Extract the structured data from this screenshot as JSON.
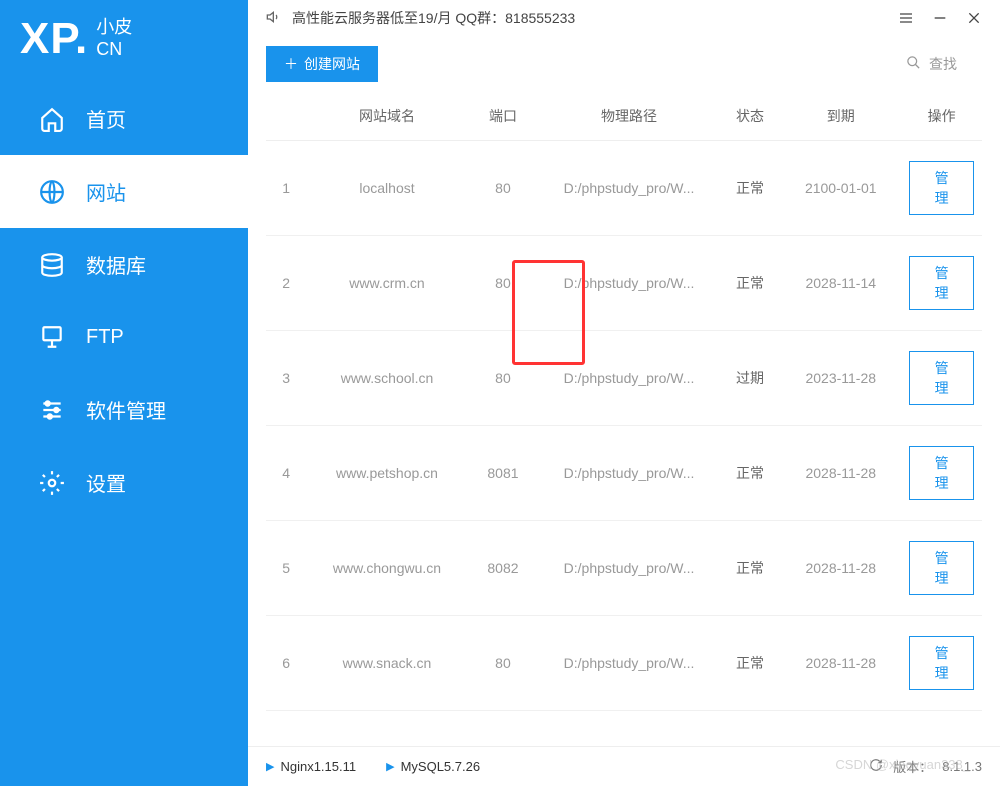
{
  "logo": {
    "xp": "XP.",
    "sub1": "小皮",
    "sub2": "CN"
  },
  "sidebar": {
    "items": [
      {
        "label": "首页",
        "icon": "home-icon"
      },
      {
        "label": "网站",
        "icon": "globe-icon"
      },
      {
        "label": "数据库",
        "icon": "database-icon"
      },
      {
        "label": "FTP",
        "icon": "ftp-icon"
      },
      {
        "label": "软件管理",
        "icon": "sliders-icon"
      },
      {
        "label": "设置",
        "icon": "gear-icon"
      }
    ]
  },
  "topbar": {
    "announcement": "高性能云服务器低至19/月  QQ群：818555233"
  },
  "toolbar": {
    "create_label": "创建网站",
    "search_placeholder": "查找"
  },
  "table": {
    "headers": {
      "domain": "网站域名",
      "port": "端口",
      "path": "物理路径",
      "status": "状态",
      "expire": "到期",
      "action": "操作"
    },
    "manage_label": "管理",
    "rows": [
      {
        "idx": "1",
        "domain": "localhost",
        "port": "80",
        "path": "D:/phpstudy_pro/W...",
        "status": "正常",
        "expire": "2100-01-01"
      },
      {
        "idx": "2",
        "domain": "www.crm.cn",
        "port": "80",
        "path": "D:/phpstudy_pro/W...",
        "status": "正常",
        "expire": "2028-11-14"
      },
      {
        "idx": "3",
        "domain": "www.school.cn",
        "port": "80",
        "path": "D:/phpstudy_pro/W...",
        "status": "过期",
        "expire": "2023-11-28"
      },
      {
        "idx": "4",
        "domain": "www.petshop.cn",
        "port": "8081",
        "path": "D:/phpstudy_pro/W...",
        "status": "正常",
        "expire": "2028-11-28"
      },
      {
        "idx": "5",
        "domain": "www.chongwu.cn",
        "port": "8082",
        "path": "D:/phpstudy_pro/W...",
        "status": "正常",
        "expire": "2028-11-28"
      },
      {
        "idx": "6",
        "domain": "www.snack.cn",
        "port": "80",
        "path": "D:/phpstudy_pro/W...",
        "status": "正常",
        "expire": "2028-11-28"
      }
    ]
  },
  "statusbar": {
    "services": [
      {
        "name": "Nginx1.15.11"
      },
      {
        "name": "MySQL5.7.26"
      }
    ],
    "version_label": "版本：",
    "version": "8.1.1.3",
    "watermark": "CSDN @xiaoyuan338_"
  }
}
